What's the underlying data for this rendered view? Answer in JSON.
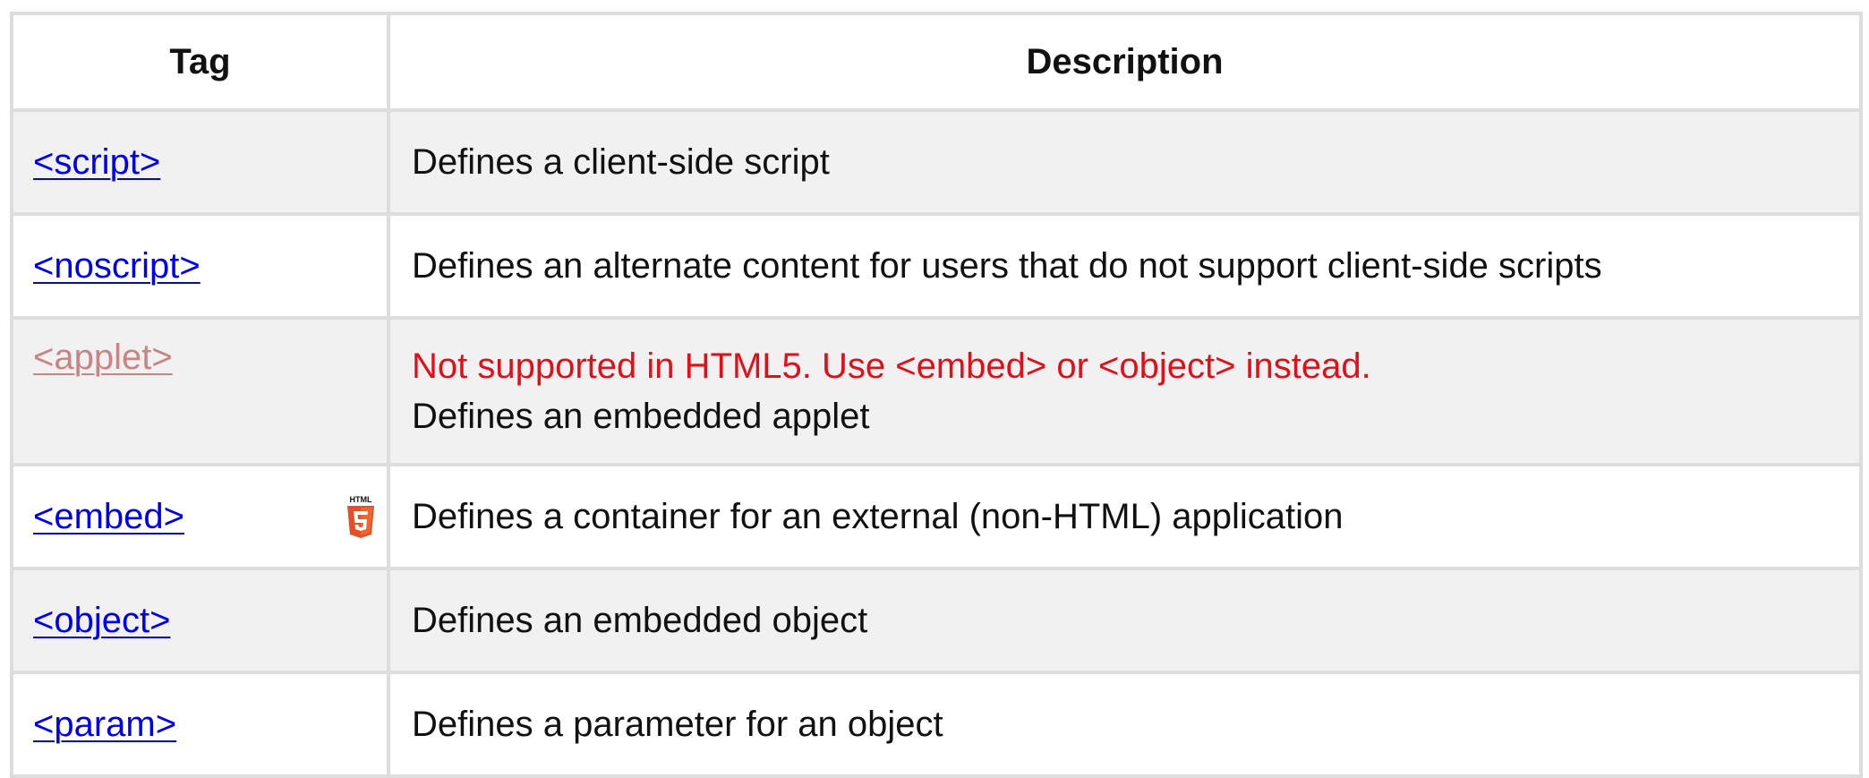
{
  "table": {
    "headers": {
      "tag": "Tag",
      "description": "Description"
    },
    "rows": [
      {
        "tag": "<script>",
        "description": "Defines a client-side script"
      },
      {
        "tag": "<noscript>",
        "description": "Defines an alternate content for users that do not support client-side scripts"
      },
      {
        "tag": "<applet>",
        "warning": "Not supported in HTML5. Use <embed> or <object> instead.",
        "description": "Defines an embedded applet",
        "deprecated": true
      },
      {
        "tag": "<embed>",
        "badge": "html5-icon",
        "badge_text": "HTML",
        "description": "Defines a container for an external (non-HTML) application"
      },
      {
        "tag": "<object>",
        "description": "Defines an embedded object"
      },
      {
        "tag": "<param>",
        "description": "Defines a parameter for an object"
      }
    ]
  },
  "colors": {
    "link": "#0000ee",
    "deprecated_link": "#c98585",
    "warning": "#e0101a",
    "row_shade": "#f1f1f1",
    "border": "#dddddd",
    "html5_badge": "#e34f26"
  }
}
